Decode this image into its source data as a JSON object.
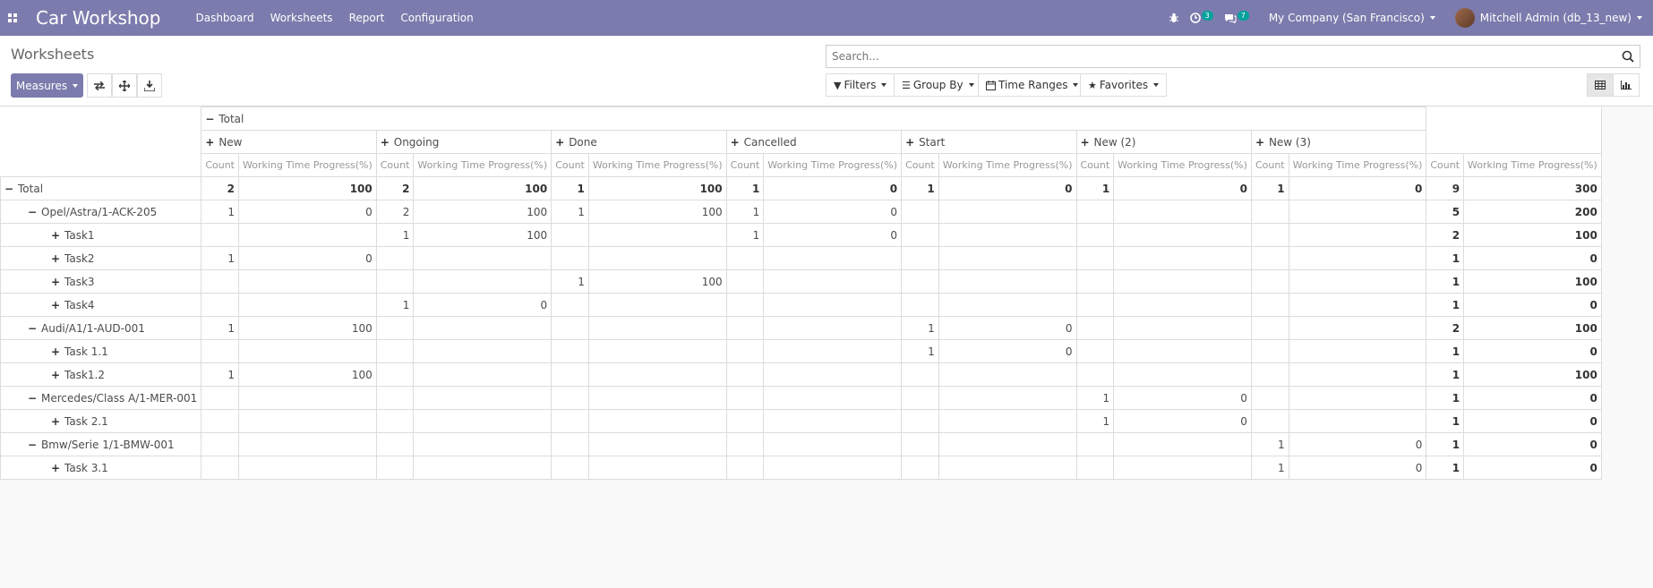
{
  "navbar": {
    "brand": "Car Workshop",
    "menu": [
      "Dashboard",
      "Worksheets",
      "Report",
      "Configuration"
    ],
    "activity_count": "3",
    "message_count": "7",
    "company": "My Company (San Francisco)",
    "user": "Mitchell Admin (db_13_new)",
    "colors": {
      "bar": "#7c7bad",
      "badge": "#00a09d"
    }
  },
  "control_panel": {
    "title": "Worksheets",
    "measures_label": "Measures",
    "search_placeholder": "Search...",
    "filters_label": "Filters",
    "groupby_label": "Group By",
    "timeranges_label": "Time Ranges",
    "favorites_label": "Favorites"
  },
  "pivot": {
    "col_group_header": "Total",
    "measure_labels": [
      "Count",
      "Working Time Progress(%)"
    ],
    "columns": [
      "New",
      "Ongoing",
      "Done",
      "Cancelled",
      "Start",
      "New (2)",
      "New (3)"
    ],
    "rows": [
      {
        "label": "Total",
        "level": 0,
        "sign": "−",
        "bold": true,
        "cells": [
          [
            "2",
            "100"
          ],
          [
            "2",
            "100"
          ],
          [
            "1",
            "100"
          ],
          [
            "1",
            "0"
          ],
          [
            "1",
            "0"
          ],
          [
            "1",
            "0"
          ],
          [
            "1",
            "0"
          ]
        ],
        "total": [
          "9",
          "300"
        ]
      },
      {
        "label": "Opel/Astra/1-ACK-205",
        "level": 1,
        "sign": "−",
        "cells": [
          [
            "1",
            "0"
          ],
          [
            "2",
            "100"
          ],
          [
            "1",
            "100"
          ],
          [
            "1",
            "0"
          ],
          [
            "",
            ""
          ],
          [
            "",
            ""
          ],
          [
            "",
            ""
          ]
        ],
        "total": [
          "5",
          "200"
        ]
      },
      {
        "label": "Task1",
        "level": 2,
        "sign": "+",
        "cells": [
          [
            "",
            ""
          ],
          [
            "1",
            "100"
          ],
          [
            "",
            ""
          ],
          [
            "1",
            "0"
          ],
          [
            "",
            ""
          ],
          [
            "",
            ""
          ],
          [
            "",
            ""
          ]
        ],
        "total": [
          "2",
          "100"
        ]
      },
      {
        "label": "Task2",
        "level": 2,
        "sign": "+",
        "cells": [
          [
            "1",
            "0"
          ],
          [
            "",
            ""
          ],
          [
            "",
            ""
          ],
          [
            "",
            ""
          ],
          [
            "",
            ""
          ],
          [
            "",
            ""
          ],
          [
            "",
            ""
          ]
        ],
        "total": [
          "1",
          "0"
        ]
      },
      {
        "label": "Task3",
        "level": 2,
        "sign": "+",
        "cells": [
          [
            "",
            ""
          ],
          [
            "",
            ""
          ],
          [
            "1",
            "100"
          ],
          [
            "",
            ""
          ],
          [
            "",
            ""
          ],
          [
            "",
            ""
          ],
          [
            "",
            ""
          ]
        ],
        "total": [
          "1",
          "100"
        ]
      },
      {
        "label": "Task4",
        "level": 2,
        "sign": "+",
        "cells": [
          [
            "",
            ""
          ],
          [
            "1",
            "0"
          ],
          [
            "",
            ""
          ],
          [
            "",
            ""
          ],
          [
            "",
            ""
          ],
          [
            "",
            ""
          ],
          [
            "",
            ""
          ]
        ],
        "total": [
          "1",
          "0"
        ]
      },
      {
        "label": "Audi/A1/1-AUD-001",
        "level": 1,
        "sign": "−",
        "cells": [
          [
            "1",
            "100"
          ],
          [
            "",
            ""
          ],
          [
            "",
            ""
          ],
          [
            "",
            ""
          ],
          [
            "1",
            "0"
          ],
          [
            "",
            ""
          ],
          [
            "",
            ""
          ]
        ],
        "total": [
          "2",
          "100"
        ]
      },
      {
        "label": "Task 1.1",
        "level": 2,
        "sign": "+",
        "cells": [
          [
            "",
            ""
          ],
          [
            "",
            ""
          ],
          [
            "",
            ""
          ],
          [
            "",
            ""
          ],
          [
            "1",
            "0"
          ],
          [
            "",
            ""
          ],
          [
            "",
            ""
          ]
        ],
        "total": [
          "1",
          "0"
        ]
      },
      {
        "label": "Task1.2",
        "level": 2,
        "sign": "+",
        "cells": [
          [
            "1",
            "100"
          ],
          [
            "",
            ""
          ],
          [
            "",
            ""
          ],
          [
            "",
            ""
          ],
          [
            "",
            ""
          ],
          [
            "",
            ""
          ],
          [
            "",
            ""
          ]
        ],
        "total": [
          "1",
          "100"
        ]
      },
      {
        "label": "Mercedes/Class A/1-MER-001",
        "level": 1,
        "sign": "−",
        "cells": [
          [
            "",
            ""
          ],
          [
            "",
            ""
          ],
          [
            "",
            ""
          ],
          [
            "",
            ""
          ],
          [
            "",
            ""
          ],
          [
            "1",
            "0"
          ],
          [
            "",
            ""
          ]
        ],
        "total": [
          "1",
          "0"
        ]
      },
      {
        "label": "Task 2.1",
        "level": 2,
        "sign": "+",
        "cells": [
          [
            "",
            ""
          ],
          [
            "",
            ""
          ],
          [
            "",
            ""
          ],
          [
            "",
            ""
          ],
          [
            "",
            ""
          ],
          [
            "1",
            "0"
          ],
          [
            "",
            ""
          ]
        ],
        "total": [
          "1",
          "0"
        ]
      },
      {
        "label": "Bmw/Serie 1/1-BMW-001",
        "level": 1,
        "sign": "−",
        "cells": [
          [
            "",
            ""
          ],
          [
            "",
            ""
          ],
          [
            "",
            ""
          ],
          [
            "",
            ""
          ],
          [
            "",
            ""
          ],
          [
            "",
            ""
          ],
          [
            "1",
            "0"
          ]
        ],
        "total": [
          "1",
          "0"
        ]
      },
      {
        "label": "Task 3.1",
        "level": 2,
        "sign": "+",
        "cells": [
          [
            "",
            ""
          ],
          [
            "",
            ""
          ],
          [
            "",
            ""
          ],
          [
            "",
            ""
          ],
          [
            "",
            ""
          ],
          [
            "",
            ""
          ],
          [
            "1",
            "0"
          ]
        ],
        "total": [
          "1",
          "0"
        ]
      }
    ]
  }
}
